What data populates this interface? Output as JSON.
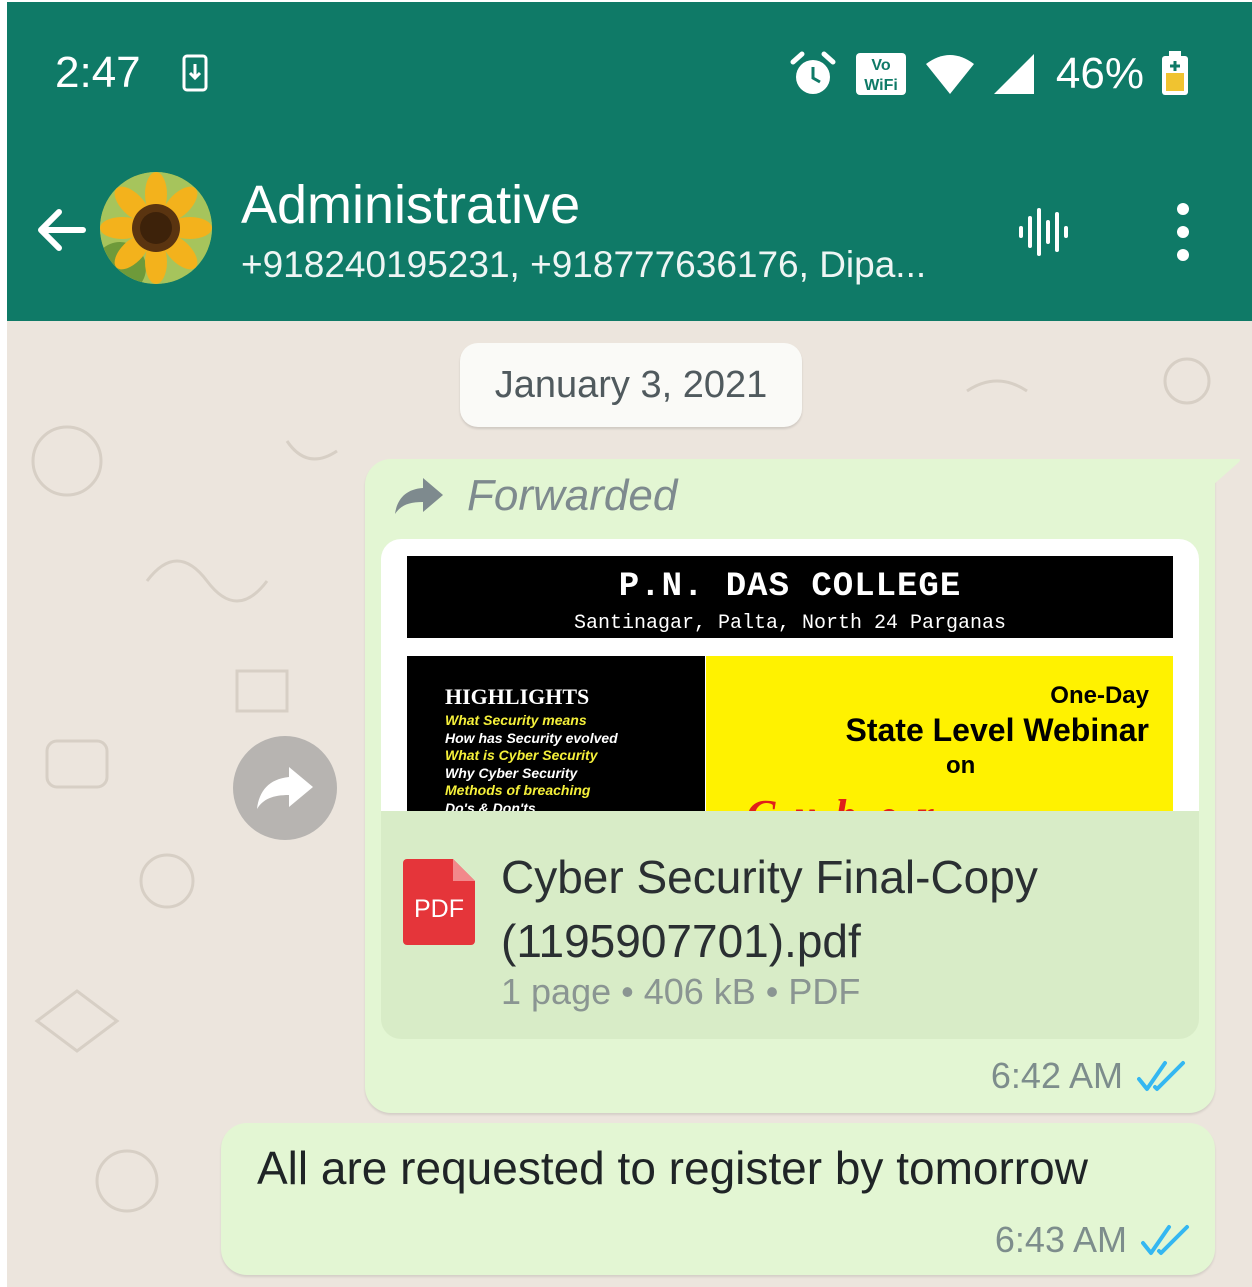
{
  "status_bar": {
    "time": "2:47",
    "battery": "46%",
    "volte_text": "Vo",
    "wifi_text": "WiFi"
  },
  "header": {
    "title": "Administrative",
    "subtitle": "+918240195231, +918777636176, Dipa..."
  },
  "date_chip": "January 3, 2021",
  "message1": {
    "forwarded_label": "Forwarded",
    "poster": {
      "college": "P.N. DAS COLLEGE",
      "address": "Santinagar, Palta, North 24 Parganas",
      "highlights_title": "HIGHLIGHTS",
      "highlights": [
        {
          "text": "What Security means",
          "color": "#f5f03a"
        },
        {
          "text": "How has Security evolved",
          "color": "#ffffff"
        },
        {
          "text": "What is Cyber Security",
          "color": "#f5f03a"
        },
        {
          "text": "Why Cyber Security",
          "color": "#ffffff"
        },
        {
          "text": "Methods of breaching",
          "color": "#f5f03a"
        },
        {
          "text": "Do's & Don'ts",
          "color": "#ffffff"
        }
      ],
      "line1": "One-Day",
      "line2": "State Level Webinar",
      "line3": "on",
      "line4": "Cyber Security"
    },
    "file_name": "Cyber Security Final-Copy (1195907701).pdf",
    "file_meta": "1 page • 406 kB • PDF",
    "pdf_icon_label": "PDF",
    "time": "6:42 AM"
  },
  "message2": {
    "text": "All are requested to register by tomorrow",
    "time": "6:43 AM"
  },
  "colors": {
    "header_green": "#0f7a67",
    "bubble_green": "#e3f6d3",
    "chat_bg": "#ece5dd",
    "tick_blue": "#34b7f1",
    "pdf_red": "#e5353a"
  }
}
